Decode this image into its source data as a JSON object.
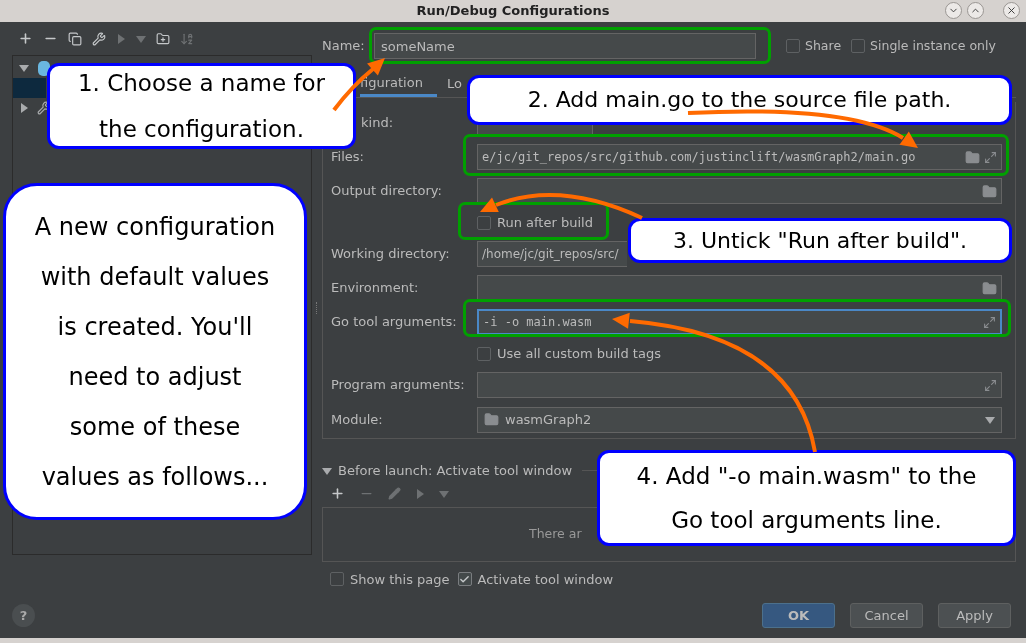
{
  "window": {
    "title": "Run/Debug Configurations"
  },
  "tree": [
    {
      "expanded": true,
      "children": [
        {
          "selected": true
        }
      ]
    },
    {
      "expanded": false
    }
  ],
  "name_field": {
    "label": "Name:",
    "value": "someName"
  },
  "options": [
    {
      "label": "Share",
      "checked": false
    },
    {
      "label": "Single instance only",
      "checked": false
    }
  ],
  "tabs": [
    {
      "label": "figuration",
      "selected": true
    },
    {
      "label": "Lo",
      "selected": false
    }
  ],
  "form": [
    {
      "kind": "field",
      "label": "kind:",
      "browse": false,
      "expand": false,
      "focused": false
    },
    {
      "kind": "field",
      "label": "Files:",
      "value": "e/jc/git_repos/src/github.com/justinclift/wasmGraph2/main.go",
      "browse": true,
      "expand": true,
      "focused": false
    },
    {
      "kind": "field",
      "label": "Output directory:",
      "browse": true,
      "expand": false,
      "focused": false
    },
    {
      "kind": "checkbox",
      "label": "Run after build",
      "checked": false
    },
    {
      "kind": "field",
      "label": "Working directory:",
      "value": "/home/jc/git_repos/src/",
      "focused": false
    },
    {
      "kind": "field",
      "label": "Environment:",
      "browse": true,
      "expand": false,
      "focused": false
    },
    {
      "kind": "field",
      "label": "Go tool arguments:",
      "value": "-i -o main.wasm",
      "browse": false,
      "expand": true,
      "focused": true
    },
    {
      "kind": "checkbox",
      "label": "Use all custom build tags",
      "checked": false
    },
    {
      "kind": "field",
      "label": "Program arguments:",
      "browse": false,
      "expand": true,
      "focused": false
    },
    {
      "kind": "dropdown",
      "label": "Module:",
      "value": "wasmGraph2"
    }
  ],
  "before_launch": {
    "title": "Before launch: Activate tool window",
    "expanded": true,
    "empty_text": "There ar"
  },
  "launch_options": [
    {
      "label": "Show this page",
      "checked": false
    },
    {
      "label": "Activate tool window",
      "checked": true
    }
  ],
  "help": {
    "label": "?"
  },
  "buttons": [
    {
      "label": "OK",
      "default": true
    },
    {
      "label": "Cancel",
      "default": false
    },
    {
      "label": "Apply",
      "default": false
    }
  ],
  "callouts": [
    {
      "lines": [
        "1. Choose a name for",
        "the configuration."
      ]
    },
    {
      "lines": [
        "2. Add main.go to the source file path."
      ]
    },
    {
      "lines": [
        "3. Untick \"Run after build\"."
      ]
    },
    {
      "lines": [
        "A new configuration",
        "with default values",
        "is created.  You'll",
        "need to adjust",
        "some of these",
        "values as follows..."
      ]
    },
    {
      "lines": [
        "4. Add \"-o main.wasm\" to the",
        "Go tool arguments line."
      ]
    }
  ]
}
